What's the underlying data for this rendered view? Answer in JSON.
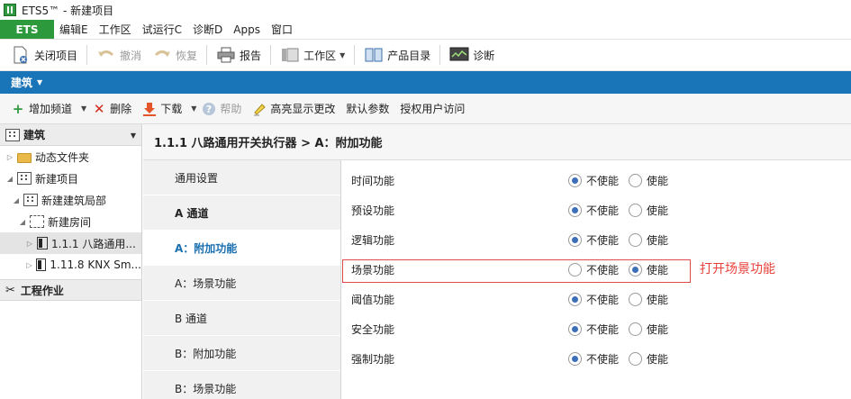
{
  "window": {
    "title": "ETS5™ - 新建项目"
  },
  "menubar": {
    "ets_tab": "ETS",
    "items": [
      "编辑E",
      "工作区",
      "试运行C",
      "诊断D",
      "Apps",
      "窗口"
    ]
  },
  "toolbar": {
    "close_project": "关闭项目",
    "undo": "撤消",
    "redo": "恢复",
    "report": "报告",
    "workspace": "工作区",
    "catalog": "产品目录",
    "diagnostics": "诊断"
  },
  "bluebar": {
    "label": "建筑"
  },
  "toolbar2": {
    "add_channel": "增加频道",
    "delete": "删除",
    "download": "下载",
    "help": "帮助",
    "highlight_changes": "高亮显示更改",
    "default_params": "默认参数",
    "authorize": "授权用户访问"
  },
  "tree": {
    "header": "建筑",
    "items": [
      {
        "label": "动态文件夹"
      },
      {
        "label": "新建项目"
      },
      {
        "label": "新建建筑局部"
      },
      {
        "label": "新建房间"
      },
      {
        "label": "1.1.1 八路通用..."
      },
      {
        "label": "1.11.8 KNX Sm..."
      }
    ],
    "section": "工程作业"
  },
  "breadcrumb": {
    "text": "1.1.1 八路通用开关执行器 > A：附加功能"
  },
  "channels": [
    {
      "label": "通用设置"
    },
    {
      "label": "A 通道"
    },
    {
      "label": "A：附加功能"
    },
    {
      "label": "A：场景功能"
    },
    {
      "label": "B 通道"
    },
    {
      "label": "B：附加功能"
    },
    {
      "label": "B：场景功能"
    }
  ],
  "options": {
    "off": "不使能",
    "on": "使能"
  },
  "params": [
    {
      "label": "时间功能",
      "enabled": false
    },
    {
      "label": "预设功能",
      "enabled": false
    },
    {
      "label": "逻辑功能",
      "enabled": false
    },
    {
      "label": "场景功能",
      "enabled": true
    },
    {
      "label": "阈值功能",
      "enabled": false
    },
    {
      "label": "安全功能",
      "enabled": false
    },
    {
      "label": "强制功能",
      "enabled": false
    }
  ],
  "annotation": {
    "text": "打开场景功能",
    "color": "#e8403a"
  },
  "colors": {
    "accent": "#1a74b8",
    "ets_green": "#2c9a3c",
    "active_channel": "#1a6fb1"
  }
}
